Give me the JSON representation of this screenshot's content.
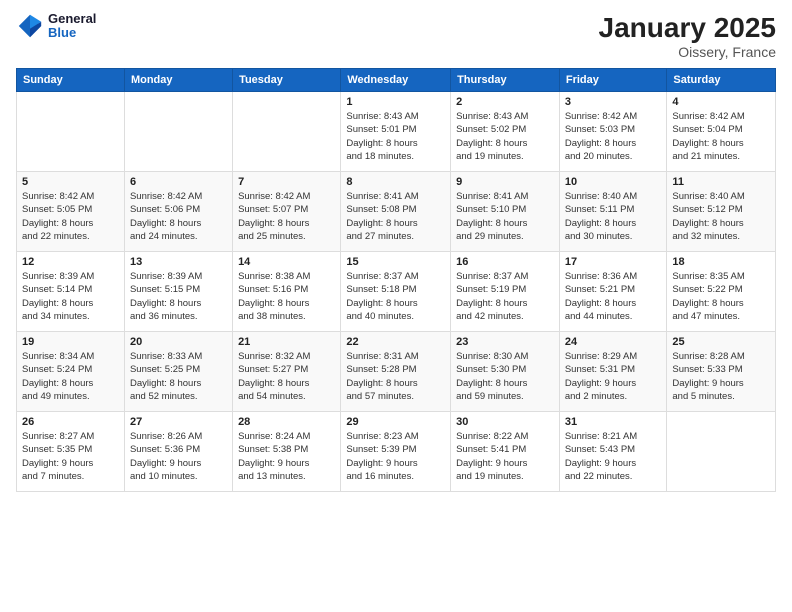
{
  "logo": {
    "line1": "General",
    "line2": "Blue"
  },
  "title": "January 2025",
  "subtitle": "Oissery, France",
  "weekdays": [
    "Sunday",
    "Monday",
    "Tuesday",
    "Wednesday",
    "Thursday",
    "Friday",
    "Saturday"
  ],
  "weeks": [
    [
      {
        "day": "",
        "detail": ""
      },
      {
        "day": "",
        "detail": ""
      },
      {
        "day": "",
        "detail": ""
      },
      {
        "day": "1",
        "detail": "Sunrise: 8:43 AM\nSunset: 5:01 PM\nDaylight: 8 hours\nand 18 minutes."
      },
      {
        "day": "2",
        "detail": "Sunrise: 8:43 AM\nSunset: 5:02 PM\nDaylight: 8 hours\nand 19 minutes."
      },
      {
        "day": "3",
        "detail": "Sunrise: 8:42 AM\nSunset: 5:03 PM\nDaylight: 8 hours\nand 20 minutes."
      },
      {
        "day": "4",
        "detail": "Sunrise: 8:42 AM\nSunset: 5:04 PM\nDaylight: 8 hours\nand 21 minutes."
      }
    ],
    [
      {
        "day": "5",
        "detail": "Sunrise: 8:42 AM\nSunset: 5:05 PM\nDaylight: 8 hours\nand 22 minutes."
      },
      {
        "day": "6",
        "detail": "Sunrise: 8:42 AM\nSunset: 5:06 PM\nDaylight: 8 hours\nand 24 minutes."
      },
      {
        "day": "7",
        "detail": "Sunrise: 8:42 AM\nSunset: 5:07 PM\nDaylight: 8 hours\nand 25 minutes."
      },
      {
        "day": "8",
        "detail": "Sunrise: 8:41 AM\nSunset: 5:08 PM\nDaylight: 8 hours\nand 27 minutes."
      },
      {
        "day": "9",
        "detail": "Sunrise: 8:41 AM\nSunset: 5:10 PM\nDaylight: 8 hours\nand 29 minutes."
      },
      {
        "day": "10",
        "detail": "Sunrise: 8:40 AM\nSunset: 5:11 PM\nDaylight: 8 hours\nand 30 minutes."
      },
      {
        "day": "11",
        "detail": "Sunrise: 8:40 AM\nSunset: 5:12 PM\nDaylight: 8 hours\nand 32 minutes."
      }
    ],
    [
      {
        "day": "12",
        "detail": "Sunrise: 8:39 AM\nSunset: 5:14 PM\nDaylight: 8 hours\nand 34 minutes."
      },
      {
        "day": "13",
        "detail": "Sunrise: 8:39 AM\nSunset: 5:15 PM\nDaylight: 8 hours\nand 36 minutes."
      },
      {
        "day": "14",
        "detail": "Sunrise: 8:38 AM\nSunset: 5:16 PM\nDaylight: 8 hours\nand 38 minutes."
      },
      {
        "day": "15",
        "detail": "Sunrise: 8:37 AM\nSunset: 5:18 PM\nDaylight: 8 hours\nand 40 minutes."
      },
      {
        "day": "16",
        "detail": "Sunrise: 8:37 AM\nSunset: 5:19 PM\nDaylight: 8 hours\nand 42 minutes."
      },
      {
        "day": "17",
        "detail": "Sunrise: 8:36 AM\nSunset: 5:21 PM\nDaylight: 8 hours\nand 44 minutes."
      },
      {
        "day": "18",
        "detail": "Sunrise: 8:35 AM\nSunset: 5:22 PM\nDaylight: 8 hours\nand 47 minutes."
      }
    ],
    [
      {
        "day": "19",
        "detail": "Sunrise: 8:34 AM\nSunset: 5:24 PM\nDaylight: 8 hours\nand 49 minutes."
      },
      {
        "day": "20",
        "detail": "Sunrise: 8:33 AM\nSunset: 5:25 PM\nDaylight: 8 hours\nand 52 minutes."
      },
      {
        "day": "21",
        "detail": "Sunrise: 8:32 AM\nSunset: 5:27 PM\nDaylight: 8 hours\nand 54 minutes."
      },
      {
        "day": "22",
        "detail": "Sunrise: 8:31 AM\nSunset: 5:28 PM\nDaylight: 8 hours\nand 57 minutes."
      },
      {
        "day": "23",
        "detail": "Sunrise: 8:30 AM\nSunset: 5:30 PM\nDaylight: 8 hours\nand 59 minutes."
      },
      {
        "day": "24",
        "detail": "Sunrise: 8:29 AM\nSunset: 5:31 PM\nDaylight: 9 hours\nand 2 minutes."
      },
      {
        "day": "25",
        "detail": "Sunrise: 8:28 AM\nSunset: 5:33 PM\nDaylight: 9 hours\nand 5 minutes."
      }
    ],
    [
      {
        "day": "26",
        "detail": "Sunrise: 8:27 AM\nSunset: 5:35 PM\nDaylight: 9 hours\nand 7 minutes."
      },
      {
        "day": "27",
        "detail": "Sunrise: 8:26 AM\nSunset: 5:36 PM\nDaylight: 9 hours\nand 10 minutes."
      },
      {
        "day": "28",
        "detail": "Sunrise: 8:24 AM\nSunset: 5:38 PM\nDaylight: 9 hours\nand 13 minutes."
      },
      {
        "day": "29",
        "detail": "Sunrise: 8:23 AM\nSunset: 5:39 PM\nDaylight: 9 hours\nand 16 minutes."
      },
      {
        "day": "30",
        "detail": "Sunrise: 8:22 AM\nSunset: 5:41 PM\nDaylight: 9 hours\nand 19 minutes."
      },
      {
        "day": "31",
        "detail": "Sunrise: 8:21 AM\nSunset: 5:43 PM\nDaylight: 9 hours\nand 22 minutes."
      },
      {
        "day": "",
        "detail": ""
      }
    ]
  ]
}
